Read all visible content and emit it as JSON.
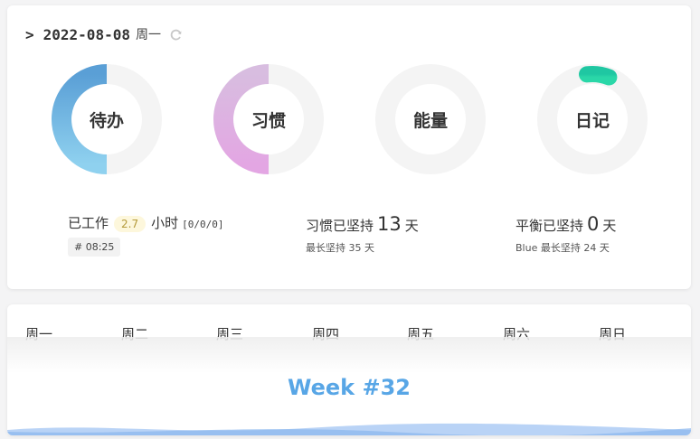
{
  "header": {
    "prompt": ">",
    "date": "2022-08-08",
    "weekday": "周一",
    "refresh_icon": "refresh-icon"
  },
  "rings": [
    {
      "label": "待办",
      "progress": 0.5,
      "colors": [
        "#5a9fd6",
        "#8fd1ef"
      ]
    },
    {
      "label": "习惯",
      "progress": 0.5,
      "colors": [
        "#d8bde0",
        "#e3a6e3"
      ]
    },
    {
      "label": "能量",
      "progress": 0,
      "colors": [
        "#dddddd",
        "#dddddd"
      ]
    },
    {
      "label": "日记",
      "progress": 0.06,
      "colors": [
        "#1fc7a2",
        "#2ad7a8"
      ]
    }
  ],
  "stats": {
    "work": {
      "prefix": "已工作",
      "hours": "2.7",
      "unit": "小时",
      "detail": "[0/0/0]",
      "tag": "# 08:25"
    },
    "habit": {
      "prefix": "习惯已坚持",
      "value": "13",
      "unit": "天",
      "sub": "最长坚持 35 天"
    },
    "balance": {
      "prefix": "平衡已坚持",
      "value": "0",
      "unit": "天",
      "sub": "Blue 最长坚持 24 天"
    }
  },
  "week": {
    "days": [
      "周一",
      "周二",
      "周三",
      "周四",
      "周五",
      "周六",
      "周日"
    ],
    "title": "Week #32"
  },
  "colors": {
    "accent": "#58a6e6",
    "track": "#f4f4f4"
  }
}
